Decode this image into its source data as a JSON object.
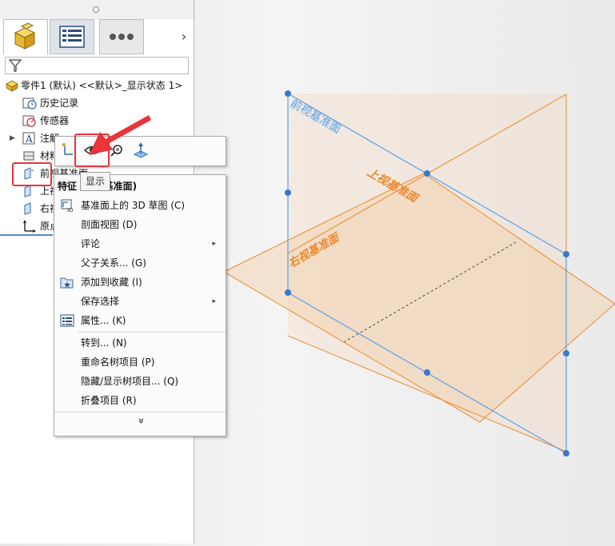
{
  "tree_panel": {
    "filter_icon": "funnel-icon",
    "root_label": "零件1 (默认) <<默认>_显示状态 1>",
    "items": [
      {
        "label": "历史记录",
        "icon": "history-icon"
      },
      {
        "label": "传感器",
        "icon": "sensor-icon"
      },
      {
        "label": "注解",
        "icon": "annotation-icon"
      },
      {
        "label": "材料",
        "icon": "material-icon"
      },
      {
        "label": "前视基准面",
        "icon": "plane-icon"
      },
      {
        "label": "上视基准面",
        "icon": "plane-icon"
      },
      {
        "label": "右视基准面",
        "icon": "plane-icon"
      },
      {
        "label": "原点",
        "icon": "origin-icon"
      }
    ]
  },
  "tooltip": "显示",
  "context_menu": {
    "header": "特征 (前视基准面)",
    "items": [
      {
        "label": "基准面上的 3D 草图 (C)",
        "submenu": false
      },
      {
        "label": "剖面视图 (D)",
        "submenu": false
      },
      {
        "label": "评论",
        "submenu": true
      },
      {
        "label": "父子关系... (G)",
        "submenu": false
      },
      {
        "label": "添加到收藏 (I)",
        "submenu": false
      },
      {
        "label": "保存选择",
        "submenu": true
      },
      {
        "label": "属性... (K)",
        "submenu": false
      },
      {
        "label": "转到... (N)",
        "submenu": false
      },
      {
        "label": "重命名树项目 (P)",
        "submenu": false
      },
      {
        "label": "隐藏/显示树项目... (Q)",
        "submenu": false
      },
      {
        "label": "折叠项目 (R)",
        "submenu": false
      }
    ],
    "submenu_arrow": "▸",
    "expand_glyph": "»"
  },
  "viewport": {
    "front_plane_label": "前视基准面",
    "top_plane_label": "上视基准面",
    "right_plane_label": "右视基准面",
    "front_color": "#5aa1e8",
    "top_color": "#e98b2e"
  },
  "colors": {
    "highlight": "#e8343a",
    "selection": "#5b89bb"
  }
}
